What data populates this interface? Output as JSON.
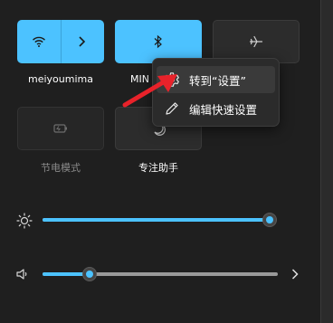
{
  "tiles": {
    "wifi": {
      "label": "meiyoumima",
      "icon": "wifi-icon",
      "state": "on"
    },
    "bluetooth": {
      "label": "MIN",
      "icon": "bluetooth-icon",
      "state": "on"
    },
    "airplane": {
      "label": "",
      "icon": "airplane-icon",
      "state": "off"
    },
    "battery_saver": {
      "label": "节电模式",
      "icon": "battery-saver-icon",
      "state": "disabled"
    },
    "focus_assist": {
      "label": "专注助手",
      "icon": "moon-icon",
      "state": "off"
    }
  },
  "context_menu": {
    "items": [
      {
        "label": "转到“设置”",
        "icon": "gear-icon"
      },
      {
        "label": "编辑快速设置",
        "icon": "pencil-icon"
      }
    ]
  },
  "brightness": {
    "icon": "sun-icon",
    "level_percent": 100
  },
  "volume": {
    "icon": "speaker-icon",
    "level_percent": 20,
    "expand_icon": "chevron-right-icon"
  },
  "colors": {
    "accent": "#4cc2ff",
    "panel": "#1f1f1f",
    "arrow": "#e8222a"
  }
}
